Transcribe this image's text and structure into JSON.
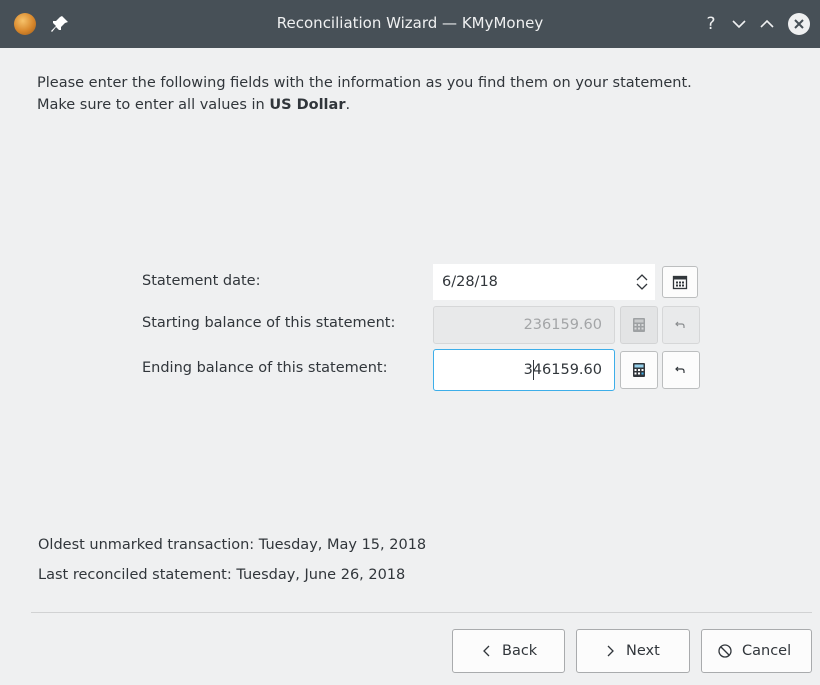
{
  "window": {
    "title": "Reconciliation Wizard — KMyMoney",
    "help_glyph": "?",
    "icons": [
      "kmymoney-app-icon",
      "pin-icon",
      "help-icon",
      "minimize-icon",
      "maximize-icon",
      "close-icon"
    ]
  },
  "intro": {
    "line1": "Please enter the following fields with the information as you find them on your statement.",
    "line2_prefix": "Make sure to enter all values in ",
    "line2_currency": "US Dollar",
    "line2_suffix": "."
  },
  "form": {
    "statement_date_label": "Statement date:",
    "statement_date_value": "6/28/18",
    "starting_balance_label": "Starting balance of this statement:",
    "starting_balance_value": "236159.60",
    "ending_balance_label": "Ending balance of this statement:",
    "ending_balance_value": "346159.60"
  },
  "info": {
    "oldest_unmarked": "Oldest unmarked transaction: Tuesday, May 15, 2018",
    "last_reconciled": "Last reconciled statement: Tuesday, June 26, 2018"
  },
  "buttons": {
    "back": "Back",
    "next": "Next",
    "cancel": "Cancel"
  },
  "colors": {
    "titlebar": "#475057",
    "focus_accent": "#3daee9",
    "window_bg": "#eff0f1",
    "close_button": "#eff0f1"
  }
}
